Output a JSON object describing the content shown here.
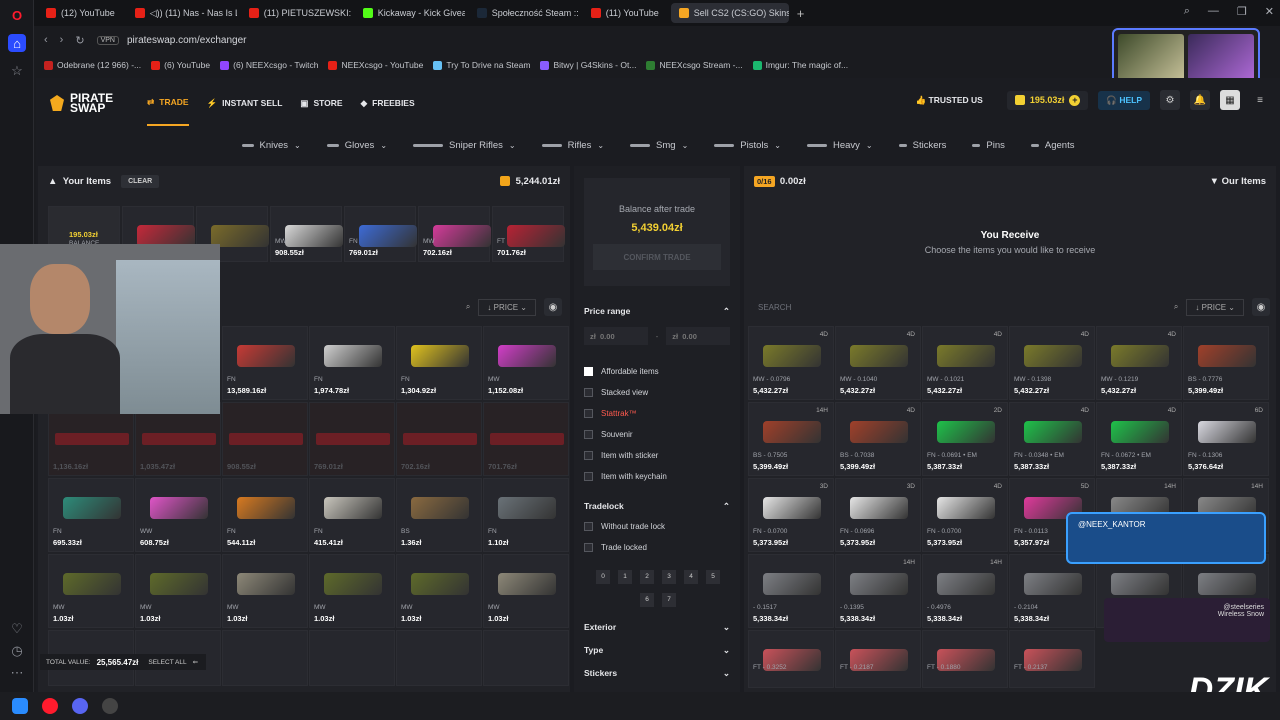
{
  "tabs": [
    {
      "label": "(12) YouTube",
      "color": "#e62117"
    },
    {
      "label": "◁)) (11) Nas - Nas Is Like I",
      "color": "#e62117"
    },
    {
      "label": "(11) PIETUSZEWSKI: SPEŁ",
      "color": "#e62117"
    },
    {
      "label": "Kickaway - Kick Giveaway",
      "color": "#53fc18"
    },
    {
      "label": "Społeczność Steam :: Ofer",
      "color": "#1b2838"
    },
    {
      "label": "(11) YouTube",
      "color": "#e62117"
    },
    {
      "label": "Sell CS2 (CS:GO) Skins | B",
      "color": "#f5a623",
      "active": true
    }
  ],
  "url": "pirateswap.com/exchanger",
  "vpn": "VPN",
  "bookmarks": [
    {
      "label": "Odebrane (12 966) -...",
      "color": "#c5221f"
    },
    {
      "label": "(6) YouTube",
      "color": "#e62117"
    },
    {
      "label": "(6) NEEXcsgo - Twitch",
      "color": "#9146ff"
    },
    {
      "label": "NEEXcsgo - YouTube",
      "color": "#e62117"
    },
    {
      "label": "Try To Drive na Steam",
      "color": "#66c0f4"
    },
    {
      "label": "Bitwy | G4Skins - Ot...",
      "color": "#8a5cff"
    },
    {
      "label": "NEEXcsgo Stream -...",
      "color": "#2e7d32"
    },
    {
      "label": "Imgur: The magic of...",
      "color": "#1bb76e"
    }
  ],
  "logo": {
    "line1": "PIRATE",
    "line2": "SWAP"
  },
  "nav": {
    "trade": "TRADE",
    "instant_sell": "INSTANT SELL",
    "store": "STORE",
    "freebies": "FREEBIES",
    "trusted": "TRUSTED US",
    "balance": "195.03zł",
    "help": "HELP"
  },
  "categories": [
    "Knives",
    "Gloves",
    "Sniper Rifles",
    "Rifles",
    "Smg",
    "Pistols",
    "Heavy",
    "Stickers",
    "Pins",
    "Agents"
  ],
  "left": {
    "title": "Your Items",
    "clear": "CLEAR",
    "total": "5,244.01zł",
    "balance_tile": {
      "value": "195.03zł",
      "label": "BALANCE"
    },
    "selected": [
      {
        "w": "",
        "p": "",
        "c": "#c5283a"
      },
      {
        "w": "",
        "p": "47zł",
        "c": "#7a6b2a"
      },
      {
        "w": "MW",
        "p": "908.55zł",
        "c": "#d8d8d8"
      },
      {
        "w": "FN",
        "p": "769.01zł",
        "c": "#3d6bd6"
      },
      {
        "w": "MW",
        "p": "702.16zł",
        "c": "#d43b9a"
      },
      {
        "w": "FT",
        "p": "701.76zł",
        "c": "#b82234"
      }
    ],
    "search_placeholder": "SEARCH",
    "sort": "PRICE",
    "row1": [
      {
        "w": "FN",
        "p": "13,589.16zł",
        "c": "#c73a35"
      },
      {
        "w": "FN",
        "p": "1,974.78zł",
        "c": "#cfcfcf"
      },
      {
        "w": "FN",
        "p": "1,304.92zł",
        "c": "#e0c21e"
      },
      {
        "w": "MW",
        "p": "1,152.08zł",
        "c": "#d23ec8"
      }
    ],
    "row2": [
      "1,136.16zł",
      "1,035.47zł",
      "908.55zł",
      "769.01zł",
      "702.16zł",
      "701.76zł"
    ],
    "row3": [
      {
        "w": "FN",
        "p": "695.33zł",
        "c": "#2d8c7a"
      },
      {
        "w": "WW",
        "p": "608.75zł",
        "c": "#e055c8"
      },
      {
        "w": "FN",
        "p": "544.11zł",
        "c": "#d87a20"
      },
      {
        "w": "FN",
        "p": "415.41zł",
        "c": "#c9c6bd"
      },
      {
        "w": "BS",
        "p": "1.36zł",
        "c": "#8a6a40"
      },
      {
        "w": "FN",
        "p": "1.10zł",
        "c": "#6a7278"
      }
    ],
    "row4": [
      {
        "w": "MW",
        "p": "1.03zł",
        "c": "#5e6a2a"
      },
      {
        "w": "MW",
        "p": "1.03zł",
        "c": "#5e6a2a"
      },
      {
        "w": "MW",
        "p": "1.03zł",
        "c": "#8d8878"
      },
      {
        "w": "MW",
        "p": "1.03zł",
        "c": "#5e6a2a"
      },
      {
        "w": "MW",
        "p": "1.03zł",
        "c": "#5e6a2a"
      },
      {
        "w": "MW",
        "p": "1.03zł",
        "c": "#8d8878"
      }
    ],
    "total_value_label": "TOTAL VALUE:",
    "total_value": "25,565.47zł",
    "select_all": "SELECT ALL"
  },
  "mid": {
    "balance_after": "Balance after trade",
    "balance_after_value": "5,439.04zł",
    "confirm": "CONFIRM TRADE",
    "price_range": "Price range",
    "min": "0.00",
    "max": "0.00",
    "currency": "zł",
    "filters": [
      "Affordable items",
      "Stacked view",
      "Stattrak™",
      "Souvenir",
      "Item with sticker",
      "Item with keychain"
    ],
    "tradelock": "Tradelock",
    "tradelock_opts": [
      "Without trade lock",
      "Trade locked"
    ],
    "days": [
      "0",
      "1",
      "2",
      "3",
      "4",
      "5",
      "6",
      "7"
    ],
    "exterior": "Exterior",
    "type": "Type",
    "stickers": "Stickers"
  },
  "right": {
    "count": "0/16",
    "total": "0.00zł",
    "title": "Our Items",
    "receive_title": "You Receive",
    "receive_sub": "Choose the items you would like to receive",
    "search_placeholder": "SEARCH",
    "sort": "PRICE",
    "rows": [
      [
        {
          "t": "4D",
          "w": "MW - 0.0796",
          "p": "5,432.27zł",
          "c": "#7a7a2a"
        },
        {
          "t": "4D",
          "w": "MW - 0.1040",
          "p": "5,432.27zł",
          "c": "#7a7a2a"
        },
        {
          "t": "4D",
          "w": "MW - 0.1021",
          "p": "5,432.27zł",
          "c": "#7a7a2a"
        },
        {
          "t": "4D",
          "w": "MW - 0.1398",
          "p": "5,432.27zł",
          "c": "#7a7a2a"
        },
        {
          "t": "4D",
          "w": "MW - 0.1219",
          "p": "5,432.27zł",
          "c": "#7a7a2a"
        },
        {
          "t": "",
          "w": "BS - 0.7776",
          "p": "5,399.49zł",
          "c": "#a0402a"
        }
      ],
      [
        {
          "t": "14H",
          "w": "BS - 0.7505",
          "p": "5,399.49zł",
          "c": "#a0402a"
        },
        {
          "t": "4D",
          "w": "BS - 0.7038",
          "p": "5,399.49zł",
          "c": "#a0402a"
        },
        {
          "t": "2D",
          "w": "FN - 0.0691 • EM",
          "p": "5,387.33zł",
          "c": "#1ec24a"
        },
        {
          "t": "4D",
          "w": "FN - 0.0348 • EM",
          "p": "5,387.33zł",
          "c": "#1ec24a"
        },
        {
          "t": "4D",
          "w": "FN - 0.0672 • EM",
          "p": "5,387.33zł",
          "c": "#1ec24a"
        },
        {
          "t": "6D",
          "w": "FN - 0.1306",
          "p": "5,376.64zł",
          "c": "#d8d8e0"
        }
      ],
      [
        {
          "t": "3D",
          "w": "FN - 0.0700",
          "p": "5,373.95zł",
          "c": "#e6e6e6"
        },
        {
          "t": "3D",
          "w": "FN - 0.0696",
          "p": "5,373.95zł",
          "c": "#e6e6e6"
        },
        {
          "t": "4D",
          "w": "FN - 0.0700",
          "p": "5,373.95zł",
          "c": "#e6e6e6"
        },
        {
          "t": "5D",
          "w": "FN - 0.0113",
          "p": "5,357.97zł",
          "c": "#e03a9c"
        },
        {
          "t": "14H",
          "w": "",
          "p": "",
          "c": "#888"
        },
        {
          "t": "14H",
          "w": "",
          "p": "",
          "c": "#888"
        }
      ],
      [
        {
          "t": "",
          "w": "- 0.1517",
          "p": "5,338.34zł",
          "c": "#7d7f84"
        },
        {
          "t": "14H",
          "w": "- 0.1395",
          "p": "5,338.34zł",
          "c": "#7d7f84"
        },
        {
          "t": "14H",
          "w": "- 0.4976",
          "p": "5,338.34zł",
          "c": "#7d7f84"
        },
        {
          "t": "1D",
          "w": "- 0.2104",
          "p": "5,338.34zł",
          "c": "#7d7f84"
        },
        {
          "t": "",
          "w": "",
          "p": "",
          "c": "#7d7f84"
        },
        {
          "t": "",
          "w": "",
          "p": "",
          "c": "#7d7f84"
        }
      ],
      [
        {
          "t": "",
          "w": "FT - 0.3252",
          "p": "",
          "c": "#c9525a"
        },
        {
          "t": "",
          "w": "FT - 0.2187",
          "p": "",
          "c": "#c9525a"
        },
        {
          "t": "",
          "w": "FT - 0.1880",
          "p": "",
          "c": "#c9525a"
        },
        {
          "t": "",
          "w": "FT - 0.2137",
          "p": "",
          "c": "#c9525a"
        }
      ]
    ]
  },
  "overlay": {
    "handle": "@NEEX_KANTOR",
    "brand": "DZIK",
    "steelseries": "@steelseries",
    "steelseries_sub": "Wireless Snow"
  }
}
